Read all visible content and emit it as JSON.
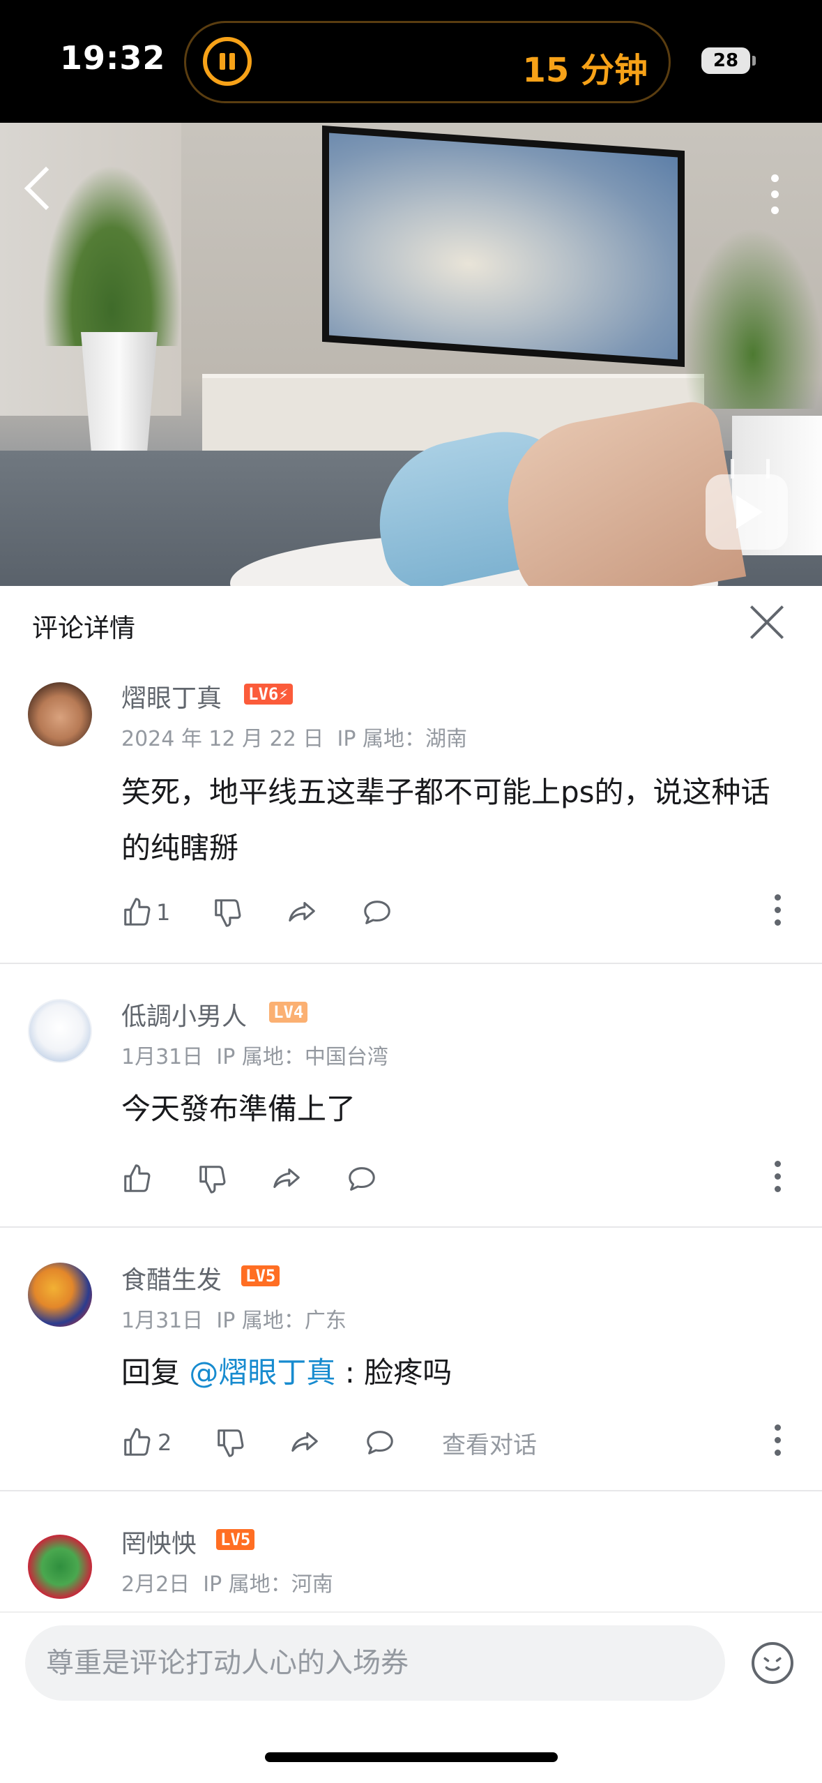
{
  "status_bar": {
    "time": "19:32",
    "timer": "15 分钟",
    "battery": "28"
  },
  "panel": {
    "title": "评论详情"
  },
  "comments": [
    {
      "username": "熠眼丁真",
      "level": "LV6⚡",
      "level_color": "#fb5b3a",
      "date": "2024 年 12 月 22 日",
      "ip": "IP 属地：湖南",
      "text": "笑死，地平线五这辈子都不可能上ps的，说这种话的纯瞎掰",
      "likes": "1"
    },
    {
      "username": "低調小男人",
      "level": "LV4",
      "level_color": "#fbb072",
      "date": "1月31日",
      "ip": "IP 属地：中国台湾",
      "text": "今天發布準備上了",
      "likes": ""
    },
    {
      "username": "食醋生发",
      "level": "LV5",
      "level_color": "#ff6e23",
      "date": "1月31日",
      "ip": "IP 属地：广东",
      "reply_prefix": "回复 ",
      "mention": "@熠眼丁真",
      "text": " : 脸疼吗",
      "likes": "2",
      "view_conversation": "查看对话"
    },
    {
      "username": "罔怏怏",
      "level": "LV5",
      "level_color": "#ff6e23",
      "date": "2月2日",
      "ip": "IP 属地：河南"
    }
  ],
  "input": {
    "placeholder": "尊重是评论打动人心的入场券"
  },
  "icons": {
    "back": "chevron-left-icon",
    "more": "more-vertical-icon",
    "close": "close-icon",
    "like": "thumb-up-icon",
    "dislike": "thumb-down-icon",
    "share": "share-icon",
    "reply": "comment-bubble-icon",
    "emoji": "emoji-icon",
    "tv": "bilibili-tv-icon"
  },
  "colors": {
    "accent": "#f7a218",
    "mention": "#178bcf"
  }
}
